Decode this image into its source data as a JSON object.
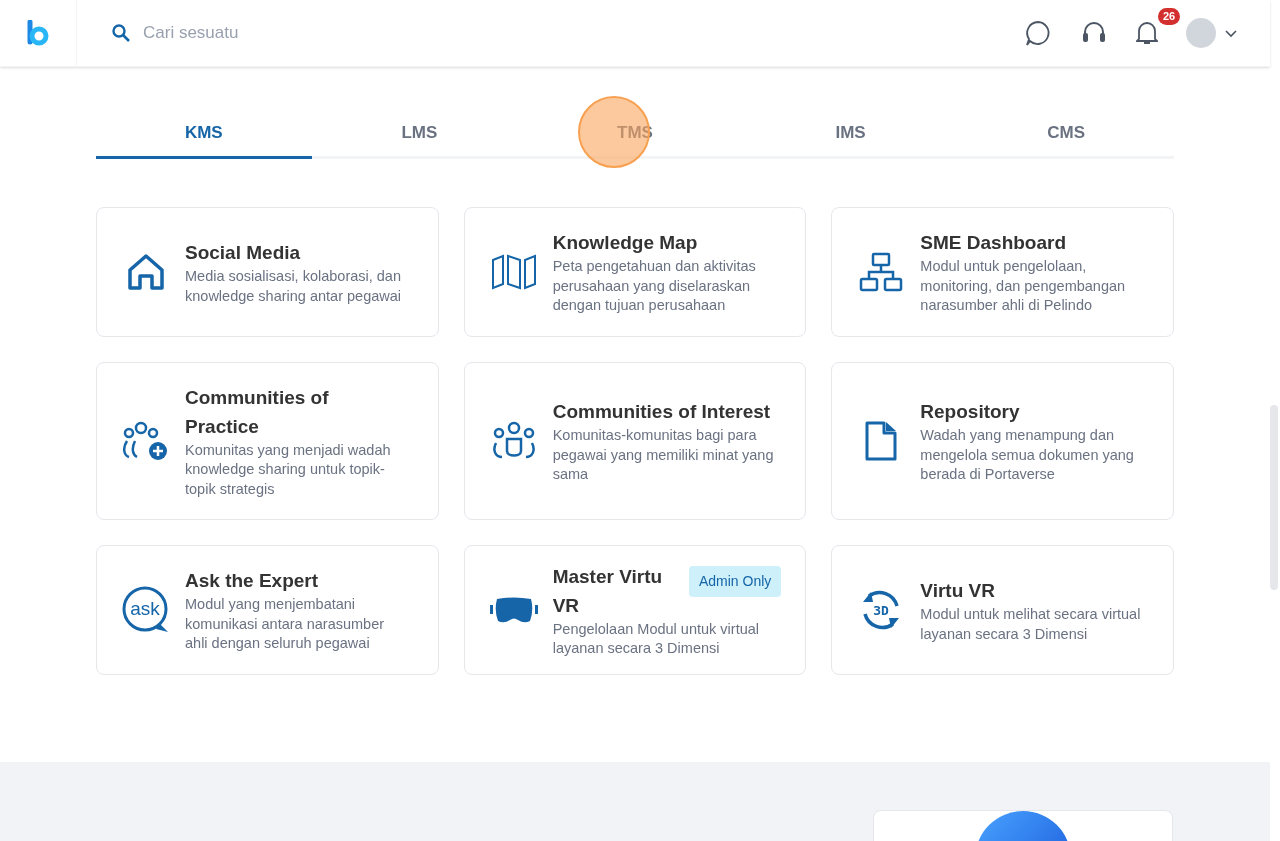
{
  "header": {
    "search": {
      "placeholder": "Cari sesuatu"
    },
    "notifications": {
      "count": "26"
    }
  },
  "tabs": [
    {
      "label": "KMS",
      "selected": true
    },
    {
      "label": "LMS",
      "selected": false
    },
    {
      "label": "TMS",
      "selected": false
    },
    {
      "label": "IMS",
      "selected": false
    },
    {
      "label": "CMS",
      "selected": false
    }
  ],
  "modules": [
    {
      "title": "Social Media",
      "description": "Media sosialisasi, kolaborasi, dan knowledge sharing antar pegawai"
    },
    {
      "title": "Knowledge Map",
      "description": "Peta pengetahuan dan aktivitas perusahaan yang diselaraskan dengan tujuan perusahaan"
    },
    {
      "title": "SME Dashboard",
      "description": "Modul untuk pengelolaan, monitoring, dan pengembangan narasumber ahli di Pelindo"
    },
    {
      "title": "Communities of Practice",
      "description": "Komunitas yang menjadi wadah knowledge sharing untuk topik-topik strategis"
    },
    {
      "title": "Communities of Interest",
      "description": "Komunitas-komunitas bagi para pegawai yang memiliki minat yang sama"
    },
    {
      "title": "Repository",
      "description": "Wadah yang menampung dan mengelola semua dokumen yang berada di Portaverse"
    },
    {
      "icon_text": "ask",
      "title": "Ask the Expert",
      "description": "Modul yang menjembatani komunikasi antara narasumber ahli dengan seluruh pegawai"
    },
    {
      "title": "Master Virtu VR",
      "badge": "Admin Only",
      "description": "Pengelolaan Modul untuk virtual layanan secara 3 Dimensi"
    },
    {
      "icon_text": "3D",
      "title": "Virtu VR",
      "description": "Modul untuk melihat secara virtual layanan secara 3 Dimensi"
    }
  ]
}
